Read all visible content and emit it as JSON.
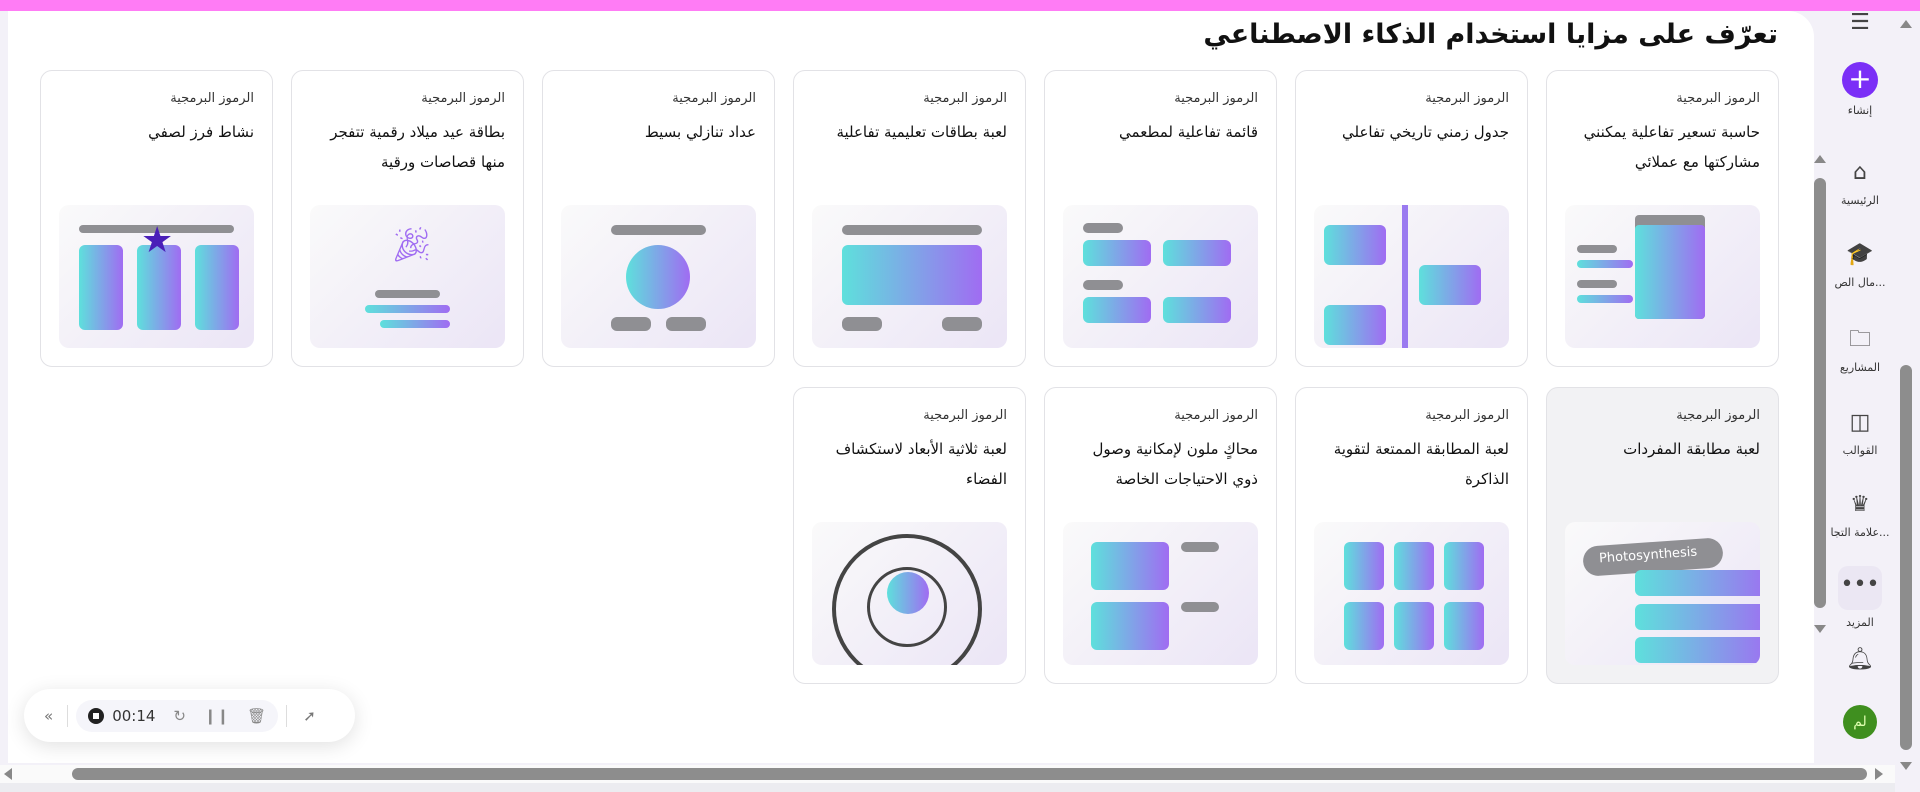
{
  "title": "تعرّف على مزايا استخدام الذكاء الاصطناعي",
  "category": "الرموز البرمجية",
  "cards": [
    {
      "name": "حاسبة تسعير تفاعلية يمكنني مشاركتها مع عملائي"
    },
    {
      "name": "جدول زمني تاريخي تفاعلي"
    },
    {
      "name": "قائمة تفاعلية لمطعمي"
    },
    {
      "name": "لعبة بطاقات تعليمية تفاعلية"
    },
    {
      "name": "عداد تنازلي بسيط"
    },
    {
      "name": "بطاقة عيد ميلاد رقمية تتفجر منها قصاصات ورقية"
    },
    {
      "name": "نشاط فرز لصفي"
    },
    {
      "name": "لعبة مطابقة المفردات",
      "illustration_text": "Photosynthesis"
    },
    {
      "name": "لعبة المطابقة الممتعة لتقوية الذاكرة"
    },
    {
      "name": "محاكٍ ملون لإمكانية وصول ذوي الاحتياجات الخاصة"
    },
    {
      "name": "لعبة ثلاثية الأبعاد لاستكشاف الفضاء"
    }
  ],
  "sidebar": {
    "create": "إنشاء",
    "home": "الرئيسية",
    "education": "...مال الص",
    "projects": "المشاريع",
    "templates": "القوالب",
    "brand": "...علامة التجا",
    "more": "المزيد",
    "avatar": "لم"
  },
  "recorder": {
    "time": "00:14"
  },
  "colors": {
    "accent": "#7b2ff7",
    "topbar": "#ff7cf5"
  }
}
